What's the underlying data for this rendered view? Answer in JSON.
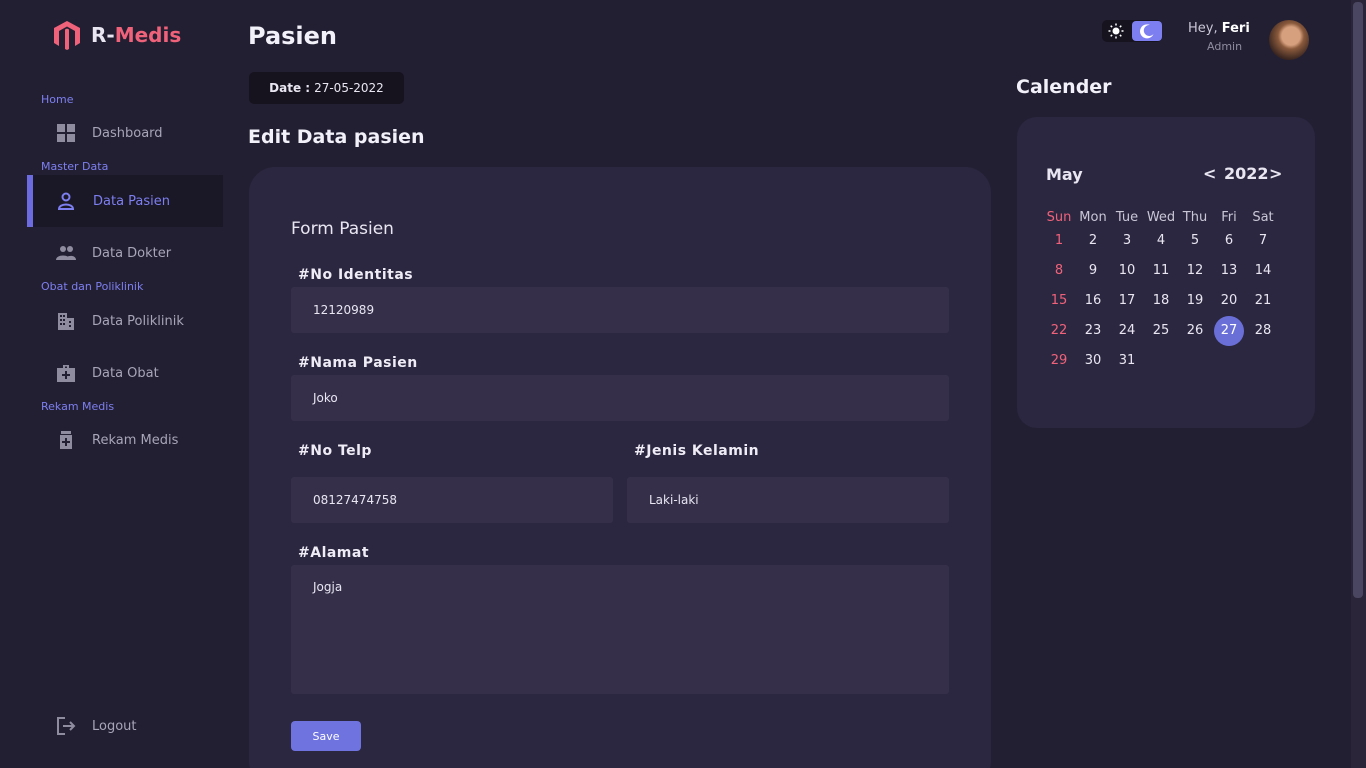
{
  "app": {
    "name_prefix": "R-",
    "name_suffix": "Medis"
  },
  "sidebar": {
    "sections": [
      {
        "label": "Home"
      },
      {
        "label": "Master Data"
      },
      {
        "label": "Obat dan Poliklinik"
      },
      {
        "label": "Rekam Medis"
      }
    ],
    "items": [
      {
        "label": "Dashboard",
        "icon": "grid-icon"
      },
      {
        "label": "Data Pasien",
        "icon": "person-icon",
        "active": true
      },
      {
        "label": "Data Dokter",
        "icon": "people-icon"
      },
      {
        "label": "Data Poliklinik",
        "icon": "building-icon"
      },
      {
        "label": "Data Obat",
        "icon": "medkit-icon"
      },
      {
        "label": "Rekam Medis",
        "icon": "medical-bottle-icon"
      }
    ],
    "logout_label": "Logout"
  },
  "header": {
    "page_title": "Pasien",
    "date_label": "Date :",
    "date_value": "27-05-2022",
    "greeting": "Hey,",
    "user_name": "Feri",
    "user_role": "Admin",
    "theme": "dark"
  },
  "main": {
    "section_title": "Edit Data pasien",
    "form_title": "Form Pasien",
    "fields": {
      "no_identitas": {
        "label": "#No Identitas",
        "value": "12120989"
      },
      "nama_pasien": {
        "label": "#Nama Pasien",
        "value": "Joko"
      },
      "no_telp": {
        "label": "#No Telp",
        "value": "08127474758"
      },
      "jenis_kelamin": {
        "label": "#Jenis Kelamin",
        "value": "Laki-laki"
      },
      "alamat": {
        "label": "#Alamat",
        "value": "Jogja"
      }
    },
    "save_label": "Save"
  },
  "calendar": {
    "title": "Calender",
    "month": "May",
    "year": "2022",
    "prev": "<",
    "next": ">",
    "weekdays": [
      "Sun",
      "Mon",
      "Tue",
      "Wed",
      "Thu",
      "Fri",
      "Sat"
    ],
    "days": [
      "1",
      "2",
      "3",
      "4",
      "5",
      "6",
      "7",
      "8",
      "9",
      "10",
      "11",
      "12",
      "13",
      "14",
      "15",
      "16",
      "17",
      "18",
      "19",
      "20",
      "21",
      "22",
      "23",
      "24",
      "25",
      "26",
      "27",
      "28",
      "29",
      "30",
      "31"
    ],
    "today": "27"
  },
  "colors": {
    "accent": "#7d7ff0",
    "brand": "#f0627a",
    "background": "#231f33",
    "card": "#2c2740"
  }
}
